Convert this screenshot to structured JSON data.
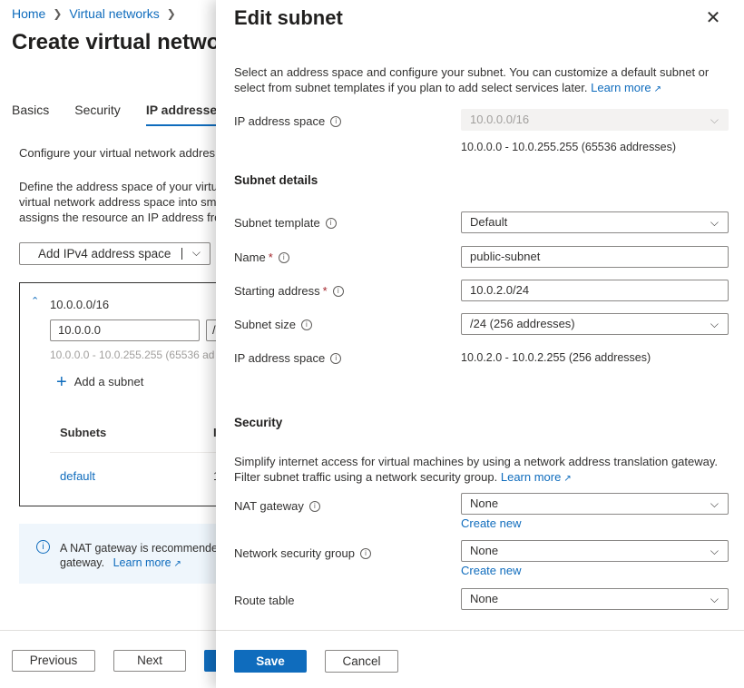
{
  "background": {
    "breadcrumb": [
      "Home",
      "Virtual networks"
    ],
    "page_title": "Create virtual networ",
    "tabs": [
      "Basics",
      "Security",
      "IP addresses"
    ],
    "configure_text": "Configure your virtual network addres",
    "define_text": [
      "Define the address space of your virtu",
      "virtual network address space into sma",
      "assigns the resource an IP address fro"
    ],
    "add_space_label": "Add IPv4 address space",
    "space": {
      "label": "10.0.0.0/16",
      "address": "10.0.0.0",
      "mask": "/",
      "range": "10.0.0.0 - 10.0.255.255 (65536 ad",
      "add_subnet": "Add a subnet",
      "subnets_header": "Subnets",
      "col2_header": "I",
      "subnet_name": "default",
      "subnet_col2": "1"
    },
    "nat_info": {
      "text1": "A NAT gateway is recommended",
      "text2": "gateway.",
      "link": "Learn more"
    },
    "buttons": {
      "previous": "Previous",
      "next": "Next"
    }
  },
  "panel": {
    "title": "Edit subnet",
    "intro": "Select an address space and configure your subnet. You can customize a default subnet or select from subnet templates if you plan to add select services later.",
    "intro_link": "Learn more",
    "ip_address_space_label": "IP address space",
    "ip_address_space_value": "10.0.0.0/16",
    "ip_address_space_range": "10.0.0.0 - 10.0.255.255 (65536 addresses)",
    "subnet_details_title": "Subnet details",
    "subnet_template_label": "Subnet template",
    "subnet_template_value": "Default",
    "name_label": "Name",
    "name_value": "public-subnet",
    "starting_address_label": "Starting address",
    "starting_address_value": "10.0.2.0/24",
    "subnet_size_label": "Subnet size",
    "subnet_size_value": "/24 (256 addresses)",
    "subnet_ip_space_label": "IP address space",
    "subnet_ip_space_value": "10.0.2.0 - 10.0.2.255 (256 addresses)",
    "security_title": "Security",
    "security_text": "Simplify internet access for virtual machines by using a network address translation gateway. Filter subnet traffic using a network security group.",
    "security_link": "Learn more",
    "nat_gateway_label": "NAT gateway",
    "nat_gateway_value": "None",
    "nat_create_new": "Create new",
    "nsg_label": "Network security group",
    "nsg_value": "None",
    "nsg_create_new": "Create new",
    "route_table_label": "Route table",
    "route_table_value": "None",
    "save": "Save",
    "cancel": "Cancel"
  },
  "icons": {
    "close": "close-icon",
    "info": "info-icon",
    "chevron": "chevron-down-icon",
    "external": "external-link-icon",
    "plus": "plus-icon"
  },
  "colors": {
    "accent": "#0f6cbd",
    "required": "#a4262c"
  }
}
